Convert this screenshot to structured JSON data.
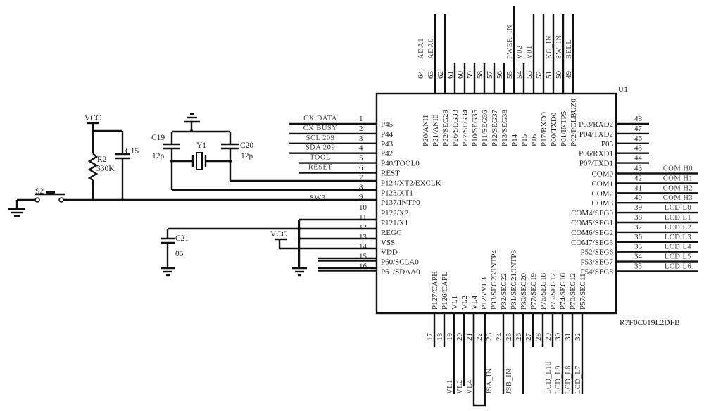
{
  "chip": {
    "designator": "U1",
    "part_number": "R7F0C019L2DFB",
    "left_pins": [
      {
        "num": "1",
        "name": "P45",
        "net": "CX_DATA"
      },
      {
        "num": "2",
        "name": "P44",
        "net": "CX_BUSY"
      },
      {
        "num": "3",
        "name": "P43",
        "net": "SCL_209"
      },
      {
        "num": "4",
        "name": "P42",
        "net": "SDA_209"
      },
      {
        "num": "5",
        "name": "P40/TOOL0",
        "net": "TOOL"
      },
      {
        "num": "6",
        "name": "REST",
        "net": "RESET"
      },
      {
        "num": "7",
        "name": "P124/XT2/EXCLK",
        "net": ""
      },
      {
        "num": "8",
        "name": "P123/XT1",
        "net": ""
      },
      {
        "num": "9",
        "name": "P137/INTP0",
        "net": "SW3"
      },
      {
        "num": "10",
        "name": "P122/X2",
        "net": ""
      },
      {
        "num": "11",
        "name": "P121/X1",
        "net": ""
      },
      {
        "num": "12",
        "name": "REGC",
        "net": ""
      },
      {
        "num": "13",
        "name": "VSS",
        "net": ""
      },
      {
        "num": "14",
        "name": "VDD",
        "net": ""
      },
      {
        "num": "15",
        "name": "P60/SCLA0",
        "net": ""
      },
      {
        "num": "16",
        "name": "P61/SDAA0",
        "net": ""
      }
    ],
    "bottom_pins": [
      {
        "num": "17",
        "name": "P127/CAPH",
        "net": ""
      },
      {
        "num": "18",
        "name": "P126/CAPL",
        "net": ""
      },
      {
        "num": "19",
        "name": "VL1",
        "net": "VL1"
      },
      {
        "num": "20",
        "name": "VL2",
        "net": "VL2"
      },
      {
        "num": "21",
        "name": "VL4",
        "net": "VL4"
      },
      {
        "num": "22",
        "name": "P125/VL3",
        "net": ""
      },
      {
        "num": "23",
        "name": "P33/SEG23/INTP4",
        "net": "JSA_IN"
      },
      {
        "num": "24",
        "name": "P32/SEG22",
        "net": ""
      },
      {
        "num": "25",
        "name": "P31/SEG21/INTP3",
        "net": "JSB_IN"
      },
      {
        "num": "26",
        "name": "P30/SEG20",
        "net": ""
      },
      {
        "num": "27",
        "name": "P77/SEG19",
        "net": ""
      },
      {
        "num": "28",
        "name": "P76/SEG18",
        "net": ""
      },
      {
        "num": "29",
        "name": "P75/SEG17",
        "net": "LCD_L10"
      },
      {
        "num": "30",
        "name": "P74/SEG16",
        "net": "LCD_L9"
      },
      {
        "num": "31",
        "name": "P70/SEG12",
        "net": "LCD_L8"
      },
      {
        "num": "32",
        "name": "P57/SEG11",
        "net": "LCD_L7"
      }
    ],
    "right_pins": [
      {
        "num": "48",
        "name": "P03/RXD2",
        "net": ""
      },
      {
        "num": "47",
        "name": "P04/TXD2",
        "net": ""
      },
      {
        "num": "46",
        "name": "P05",
        "net": ""
      },
      {
        "num": "45",
        "name": "P06/RXD1",
        "net": ""
      },
      {
        "num": "44",
        "name": "P07/TXD1",
        "net": ""
      },
      {
        "num": "43",
        "name": "COM0",
        "net": "COM_H0"
      },
      {
        "num": "42",
        "name": "COM1",
        "net": "COM_H1"
      },
      {
        "num": "41",
        "name": "COM2",
        "net": "COM_H2"
      },
      {
        "num": "40",
        "name": "COM3",
        "net": "COM_H3"
      },
      {
        "num": "39",
        "name": "COM4/SEG0",
        "net": "LCD_L0"
      },
      {
        "num": "38",
        "name": "COM5/SEG1",
        "net": "LCD_L1"
      },
      {
        "num": "37",
        "name": "COM6/SEG2",
        "net": "LCD_L2"
      },
      {
        "num": "36",
        "name": "COM7/SEG3",
        "net": "LCD_L3"
      },
      {
        "num": "35",
        "name": "P52/SEG6",
        "net": "LCD_L4"
      },
      {
        "num": "34",
        "name": "P53/SEG7",
        "net": "LCD_L5"
      },
      {
        "num": "33",
        "name": "P54/SEG8",
        "net": "LCD_L6"
      }
    ],
    "top_pins": [
      {
        "num": "64",
        "name": "P20/ANI1",
        "net": "ADA1"
      },
      {
        "num": "63",
        "name": "P21/ANI0",
        "net": "ADA0"
      },
      {
        "num": "62",
        "name": "P22/SEG29",
        "net": ""
      },
      {
        "num": "61",
        "name": "P26/SEG33",
        "net": ""
      },
      {
        "num": "60",
        "name": "P27/SEG34",
        "net": ""
      },
      {
        "num": "59",
        "name": "P10/SEG35",
        "net": ""
      },
      {
        "num": "58",
        "name": "P11/SEG36",
        "net": ""
      },
      {
        "num": "57",
        "name": "P12/SEG37",
        "net": ""
      },
      {
        "num": "56",
        "name": "P13/SEG38",
        "net": ""
      },
      {
        "num": "55",
        "name": "P14",
        "net": "PWER_IN"
      },
      {
        "num": "54",
        "name": "P15",
        "net": "V02"
      },
      {
        "num": "53",
        "name": "P16",
        "net": "V01"
      },
      {
        "num": "52",
        "name": "P17/RXD0",
        "net": ""
      },
      {
        "num": "51",
        "name": "P00/TXD0",
        "net": "KG_IN"
      },
      {
        "num": "50",
        "name": "P01/INTP5",
        "net": "SW_IN"
      },
      {
        "num": "49",
        "name": "P02/PCLBUZ0",
        "net": "BELL"
      }
    ]
  },
  "components": {
    "vcc_left": "VCC",
    "vcc_mid": "VCC",
    "r2_ref": "R2",
    "r2_val": "330K",
    "c15_ref": "C15",
    "s2_ref": "S2",
    "c19_ref": "C19",
    "c19_val": "12p",
    "c20_ref": "C20",
    "c20_val": "12p",
    "y1_ref": "Y1",
    "c21_ref": "C21",
    "c21_val": "05"
  }
}
